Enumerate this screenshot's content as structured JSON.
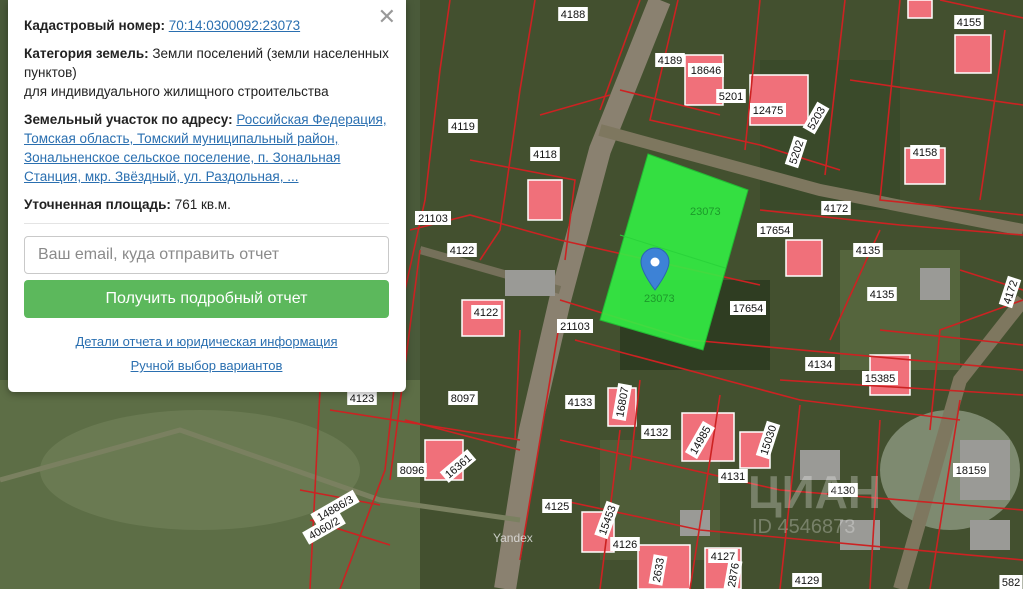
{
  "panel": {
    "cadastral_label": "Кадастровый номер:",
    "cadastral_value": "70:14:0300092:23073",
    "category_label": "Категория земель:",
    "category_value": "Земли поселений (земли населенных пунктов)",
    "category_use": "для индивидуального жилищного строительства",
    "address_label": "Земельный участок по адресу:",
    "address_value": "Российская Федерация, Томская область, Томский муниципальный район, Зональненское сельское поселение, п. Зональная Станция, мкр. Звёздный, ул. Раздольная, ...",
    "area_label": "Уточненная площадь:",
    "area_value": "761 кв.м.",
    "email_placeholder": "Ваш email, куда отправить отчет",
    "report_button": "Получить подробный отчет",
    "details_link": "Детали отчета и юридическая информация",
    "manual_link": "Ручной выбор вариантов",
    "close": "✕"
  },
  "map": {
    "selected_plot_label": "23073",
    "marker_icon": "map-pin-icon",
    "watermark_brand": "ЦИАН",
    "watermark_id": "ID 4546873",
    "provider": "Yandex",
    "plot_labels": [
      "4188",
      "4189",
      "18646",
      "5201",
      "12475",
      "4155",
      "5203",
      "4158",
      "5202",
      "4119",
      "4118",
      "21103",
      "4172",
      "17654",
      "4135",
      "4135",
      "4172",
      "4122",
      "4122",
      "17654",
      "21103",
      "4134",
      "15385",
      "4123",
      "8097",
      "4133",
      "16807",
      "4132",
      "14985",
      "15030",
      "4131",
      "4130",
      "18159",
      "8096",
      "16361",
      "14886/3",
      "4060/2",
      "4125",
      "15453",
      "4126",
      "2633",
      "4127",
      "2876",
      "4129",
      "582"
    ],
    "colors": {
      "selected_fill": "#33ee44",
      "boundary": "#cc2222",
      "roof": "#f0707a",
      "marker": "#3d82d6"
    }
  }
}
